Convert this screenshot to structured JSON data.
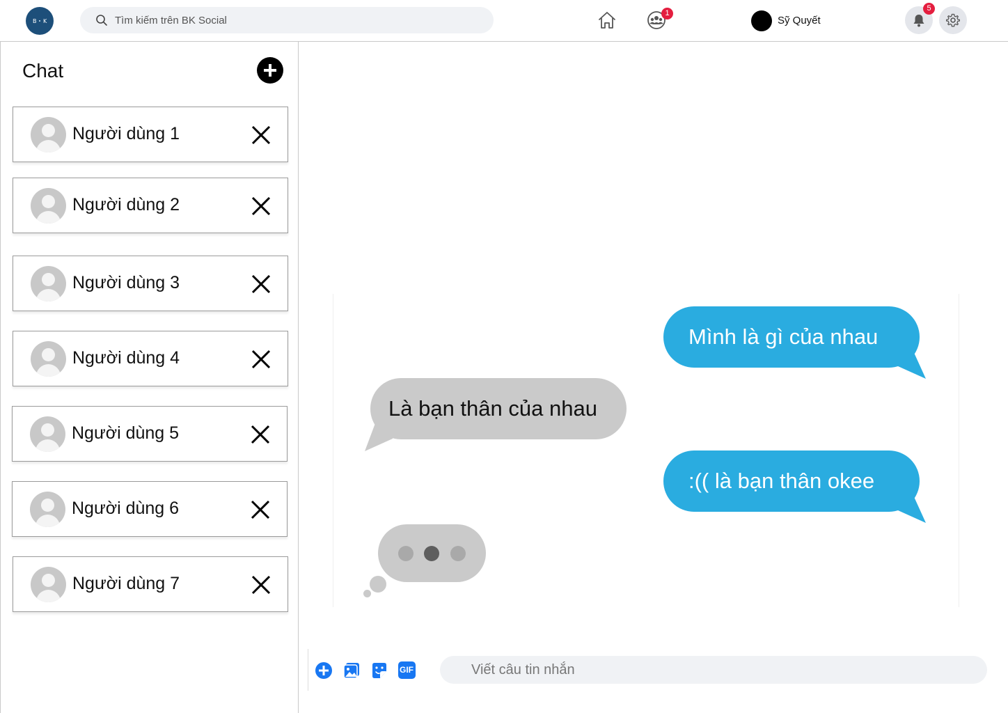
{
  "header": {
    "logo_text_left": "B",
    "logo_text_right": "K",
    "search_placeholder": "Tìm kiếm trên BK Social",
    "friends_badge": "1",
    "profile_name": "Sỹ Quyết",
    "notifications_badge": "5"
  },
  "sidebar": {
    "title": "Chat",
    "chats": [
      {
        "name": "Người dùng 1"
      },
      {
        "name": "Người dùng 2"
      },
      {
        "name": "Người dùng 3"
      },
      {
        "name": "Người dùng 4"
      },
      {
        "name": "Người dùng 5"
      },
      {
        "name": "Người dùng 6"
      },
      {
        "name": "Người dùng 7"
      }
    ]
  },
  "conversation": {
    "messages": [
      {
        "from": "me",
        "text": "Mình là gì của nhau"
      },
      {
        "from": "other",
        "text": "Là bạn thân của nhau"
      },
      {
        "from": "me",
        "text": ":(( là bạn thân okee"
      }
    ],
    "typing_indicator": true
  },
  "composer": {
    "placeholder": "Viết câu tin nhắn",
    "tools": [
      "add-icon",
      "photo-icon",
      "sticker-icon",
      "gif-icon"
    ],
    "gif_label": "GIF"
  },
  "colors": {
    "sent_bubble": "#2aace0",
    "received_bubble": "#cacaca",
    "badge": "#e41e3f",
    "accent_blue": "#1877f2"
  }
}
